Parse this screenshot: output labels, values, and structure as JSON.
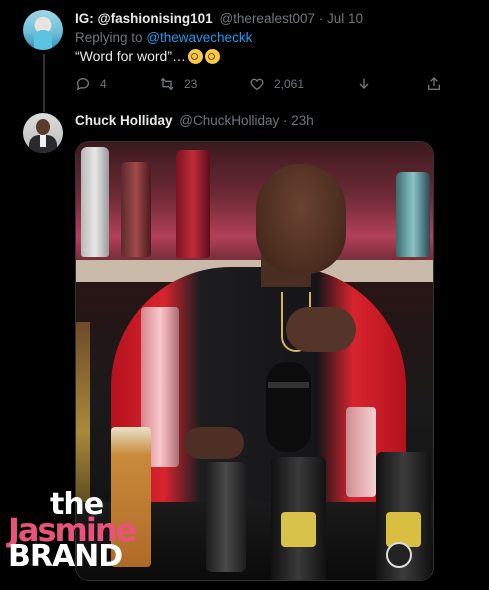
{
  "tweet1": {
    "display_name": "IG: @fashionising101",
    "handle_time": "@therealest007 · Jul 10",
    "reply_prefix": "Replying to",
    "reply_to": "@thewavecheckk",
    "text": "“Word for word”…",
    "emoji": "face-with-monocle x2",
    "actions": {
      "reply_count": "4",
      "retweet_count": "23",
      "like_count": "2,061"
    }
  },
  "tweet2": {
    "display_name": "Chuck Holliday",
    "handle_time": "@ChuckHolliday · 23h"
  },
  "watermark": {
    "the": "the",
    "jasmine": "Jasmine",
    "brand": "BRAND"
  },
  "colors": {
    "background": "#000000",
    "link": "#1d9bf0",
    "muted": "#71767b",
    "watermark_pink": "#e8537a"
  }
}
